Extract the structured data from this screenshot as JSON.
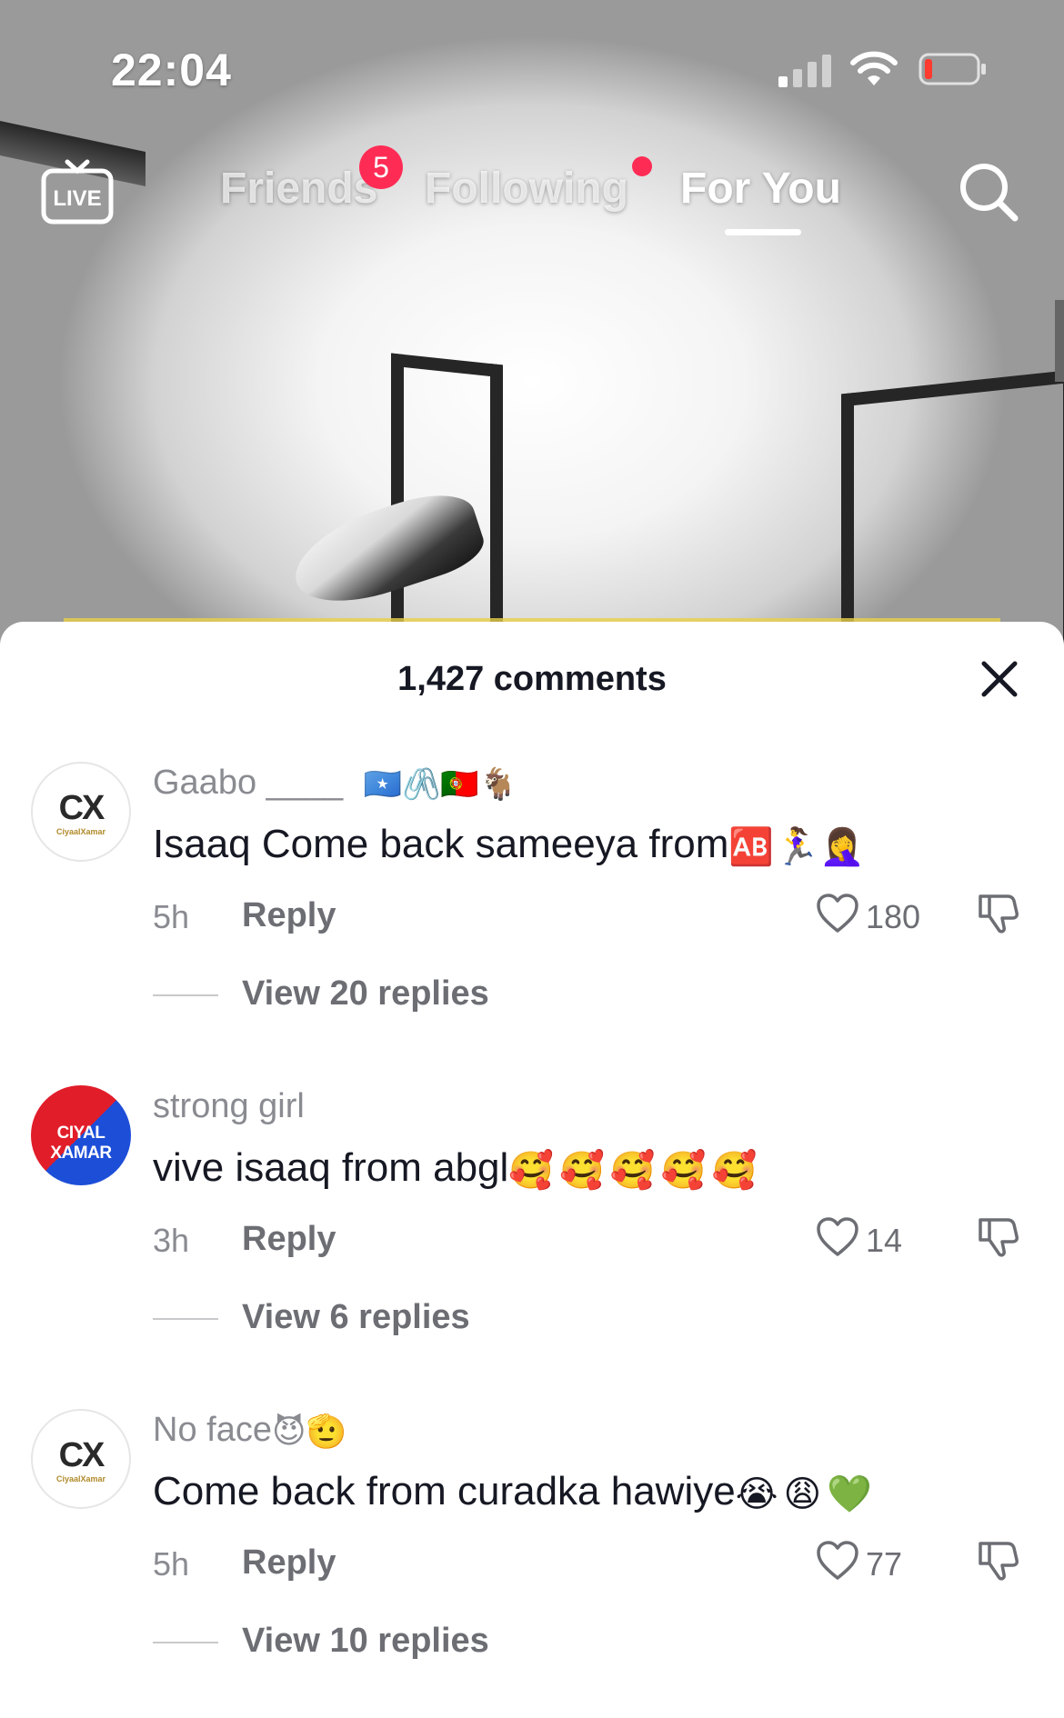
{
  "status_bar": {
    "time": "22:04"
  },
  "top_nav": {
    "live_label": "LIVE",
    "tabs": [
      {
        "label": "Friends",
        "badge": "5"
      },
      {
        "label": "Following"
      },
      {
        "label": "For You",
        "active": true
      }
    ]
  },
  "comments_sheet": {
    "title": "1,427 comments",
    "comments": [
      {
        "username": "Gaabo ____",
        "username_emojis": "🇸🇴🖇️🇵🇹🐐",
        "text": "Isaaq Come back sameeya from",
        "text_emojis": "🆎🏃‍♀️🤦‍♀️",
        "time": "5h",
        "reply_label": "Reply",
        "likes": "180",
        "view_replies": "View 20 replies",
        "avatar": "CX",
        "avatar_sub": "CiyaalXamar"
      },
      {
        "username": "strong girl",
        "username_emojis": "",
        "text": "vive isaaq from abgl",
        "text_emojis": "🥰🥰🥰🥰🥰",
        "time": "3h",
        "reply_label": "Reply",
        "likes": "14",
        "view_replies": "View 6 replies",
        "avatar": "CIYAL XAMAR"
      },
      {
        "username": "No face",
        "username_emojis": "😈🫡",
        "text": "Come back from curadka hawiye",
        "text_emojis": "😭😩💚",
        "time": "5h",
        "reply_label": "Reply",
        "likes": "77",
        "view_replies": "View 10 replies",
        "avatar": "CX",
        "avatar_sub": "CiyaalXamar"
      }
    ]
  },
  "colors": {
    "accent": "#fe2c55",
    "text": "#161823",
    "muted": "#8a8b91"
  }
}
